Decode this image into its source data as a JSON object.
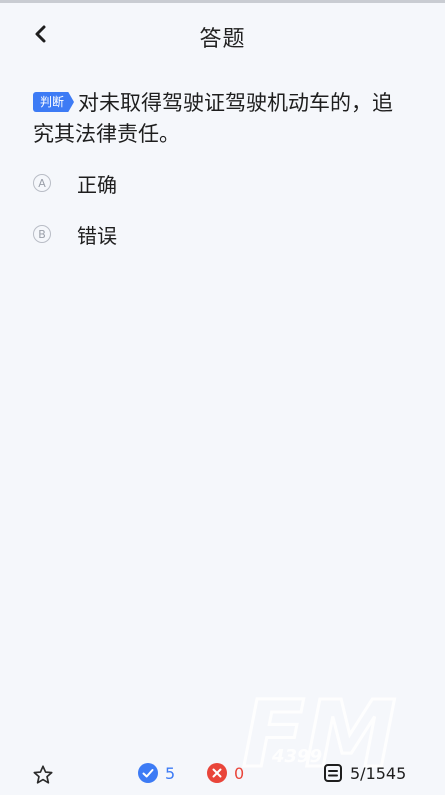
{
  "header": {
    "title": "答题"
  },
  "question": {
    "type_tag": "判断",
    "text": "对未取得驾驶证驾驶机动车的，追究其法律责任。"
  },
  "options": [
    {
      "letter": "A",
      "text": "正确"
    },
    {
      "letter": "B",
      "text": "错误"
    }
  ],
  "footer": {
    "correct_count": "5",
    "wrong_count": "0",
    "progress": "5/1545"
  },
  "watermark": {
    "text": "FM",
    "sub": "4399"
  },
  "colors": {
    "accent": "#3d7bf5",
    "correct": "#3d7bf5",
    "wrong": "#e9453a"
  }
}
